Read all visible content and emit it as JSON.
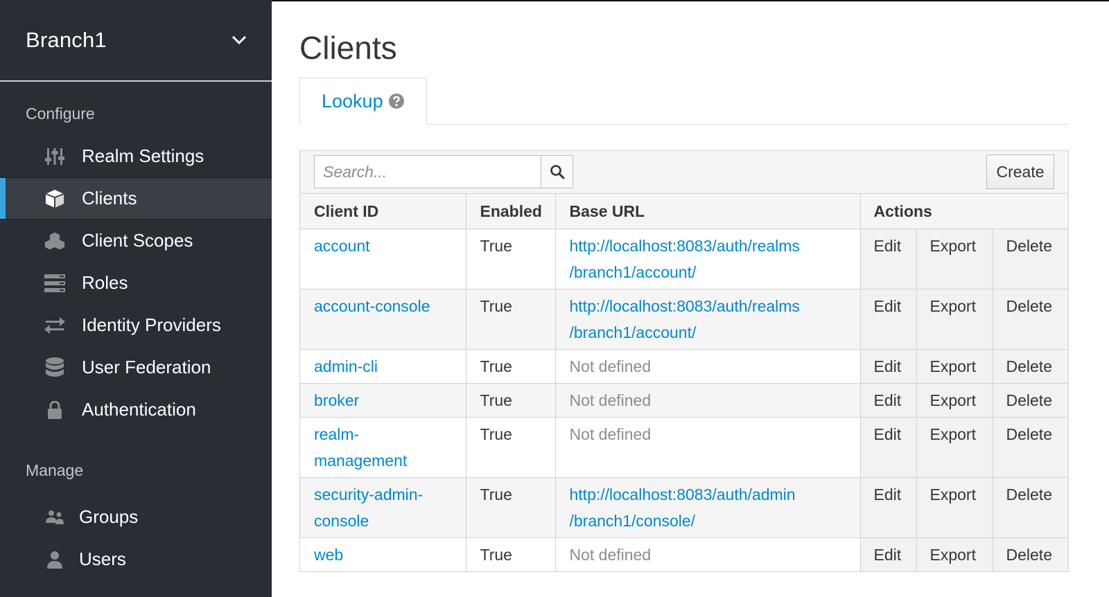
{
  "sidebar": {
    "realm": "Branch1",
    "configure_title": "Configure",
    "configure_items": [
      {
        "label": "Realm Settings",
        "icon": "sliders-icon"
      },
      {
        "label": "Clients",
        "icon": "cube-icon",
        "active": true
      },
      {
        "label": "Client Scopes",
        "icon": "cubes-icon"
      },
      {
        "label": "Roles",
        "icon": "roles-icon"
      },
      {
        "label": "Identity Providers",
        "icon": "exchange-icon"
      },
      {
        "label": "User Federation",
        "icon": "database-icon"
      },
      {
        "label": "Authentication",
        "icon": "lock-icon"
      }
    ],
    "manage_title": "Manage",
    "manage_items": [
      {
        "label": "Groups",
        "icon": "users-icon"
      },
      {
        "label": "Users",
        "icon": "user-icon"
      }
    ]
  },
  "main": {
    "title": "Clients",
    "tab_label": "Lookup",
    "search_placeholder": "Search...",
    "create_label": "Create",
    "headers": {
      "client_id": "Client ID",
      "enabled": "Enabled",
      "base_url": "Base URL",
      "actions": "Actions"
    },
    "action_labels": {
      "edit": "Edit",
      "export": "Export",
      "delete": "Delete"
    },
    "rows": [
      {
        "client_id": "account",
        "enabled": "True",
        "url_line1": "http://localhost:8083/auth/realms",
        "url_line2": "/branch1/account/",
        "defined": true
      },
      {
        "client_id": "account-console",
        "enabled": "True",
        "url_line1": "http://localhost:8083/auth/realms",
        "url_line2": "/branch1/account/",
        "defined": true
      },
      {
        "client_id": "admin-cli",
        "enabled": "True",
        "url_line1": "Not defined",
        "url_line2": "",
        "defined": false
      },
      {
        "client_id": "broker",
        "enabled": "True",
        "url_line1": "Not defined",
        "url_line2": "",
        "defined": false
      },
      {
        "client_id": "realm-management",
        "enabled": "True",
        "url_line1": "Not defined",
        "url_line2": "",
        "defined": false
      },
      {
        "client_id": "security-admin-console",
        "enabled": "True",
        "url_line1": "http://localhost:8083/auth/admin",
        "url_line2": "/branch1/console/",
        "defined": true
      },
      {
        "client_id": "web",
        "enabled": "True",
        "url_line1": "Not defined",
        "url_line2": "",
        "defined": false
      }
    ]
  },
  "colors": {
    "sidebar_bg": "#292e34",
    "active_item_bg": "#393f44",
    "active_indicator": "#39a5dc",
    "link": "#0088ce",
    "muted": "#8b8d8f"
  }
}
